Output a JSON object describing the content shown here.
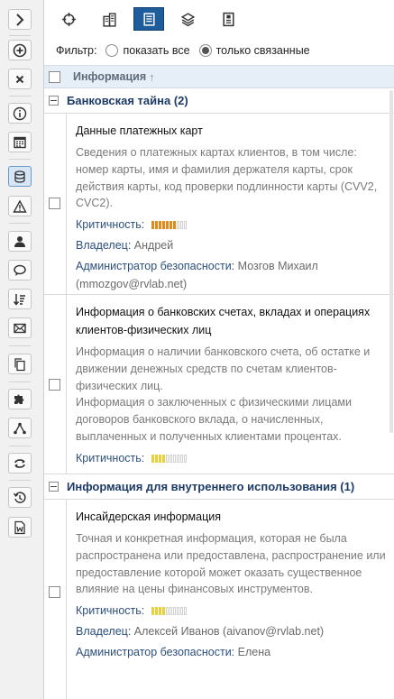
{
  "toolbar": {
    "left_icons": [
      "chevron-right-icon",
      "plus-circle-icon",
      "close-icon",
      "info-icon",
      "calendar-icon",
      "database-icon",
      "warning-icon",
      "user-icon",
      "chat-icon",
      "sort-icon",
      "mail-icon",
      "copy-icon",
      "puzzle-icon",
      "network-icon",
      "switch-icon",
      "history-icon",
      "word-doc-icon"
    ],
    "tab_icons": [
      "target-icon",
      "buildings-icon",
      "list-document-icon",
      "layers-icon",
      "document-icon"
    ]
  },
  "filter": {
    "label": "Фильтр:",
    "options": [
      "показать все",
      "только связанные"
    ],
    "selected_index": 1
  },
  "table": {
    "header": "Информация",
    "sort_glyph": "↑"
  },
  "groups": [
    {
      "title": "Банковская тайна (2)",
      "items": [
        {
          "title": "Данные платежных карт",
          "description": "Сведения о платежных картах клиентов, в том числе: номер карты, имя и фамилия держателя карты, срок действия карты, код проверки подлинности карты (CVV2, CVC2).",
          "criticality_label": "Критичность:",
          "criticality_level": 7,
          "criticality_max": 10,
          "criticality_color": "#e38a1c",
          "owner_label": "Владелец:",
          "owner_value": "Андрей",
          "admin_label": "Администратор безопасности:",
          "admin_value": "Мозгов Михаил (mmozgov@rvlab.net)"
        },
        {
          "title": "Информация о банковских счетах, вкладах и операциях клиентов-физических лиц",
          "description": "Информация о наличии банковского счета, об остатке и движении денежных средств по счетам клиентов-физических лиц.\nИнформация о заключенных с физическими лицами договоров банковского вклада, о начисленных, выплаченных и полученных клиентами процентах.",
          "criticality_label": "Критичность:",
          "criticality_level": 4,
          "criticality_max": 10,
          "criticality_color": "#e8d23c"
        }
      ]
    },
    {
      "title": "Информация для внутреннего использования (1)",
      "items": [
        {
          "title": "Инсайдерская информация",
          "description": "Точная и конкретная информация, которая не была распространена или предоставлена, распространение или предоставление которой может оказать существенное влияние на цены финансовых инструментов.",
          "criticality_label": "Критичность:",
          "criticality_level": 4,
          "criticality_max": 10,
          "criticality_color": "#e8d23c",
          "owner_label": "Владелец:",
          "owner_value": "Алексей Иванов (aivanov@rvlab.net)",
          "admin_label": "Администратор безопасности:",
          "admin_value": "Елена"
        }
      ]
    }
  ]
}
